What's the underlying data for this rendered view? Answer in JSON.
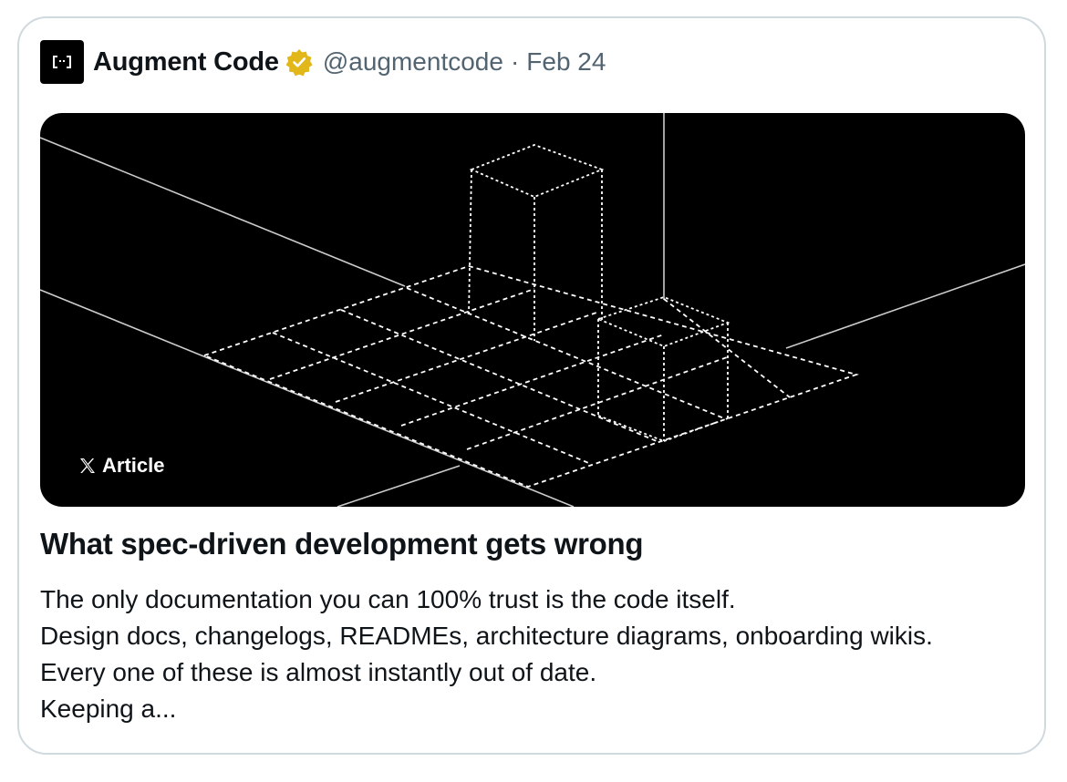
{
  "post": {
    "author_name": "Augment Code",
    "author_handle": "@augmentcode",
    "separator": "·",
    "date": "Feb 24",
    "verified_badge_color": "#e2b719",
    "avatar_icon": "augment-logo-icon"
  },
  "media": {
    "tag_label": "Article",
    "tag_icon": "x-logo-icon",
    "background": "#000000"
  },
  "article": {
    "title": "What spec-driven development gets wrong",
    "lines": [
      "The only documentation you can 100% trust is the code itself.",
      "Design docs, changelogs, READMEs, architecture diagrams, onboarding wikis.",
      "Every one of these is almost instantly out of date.",
      "Keeping a..."
    ]
  }
}
